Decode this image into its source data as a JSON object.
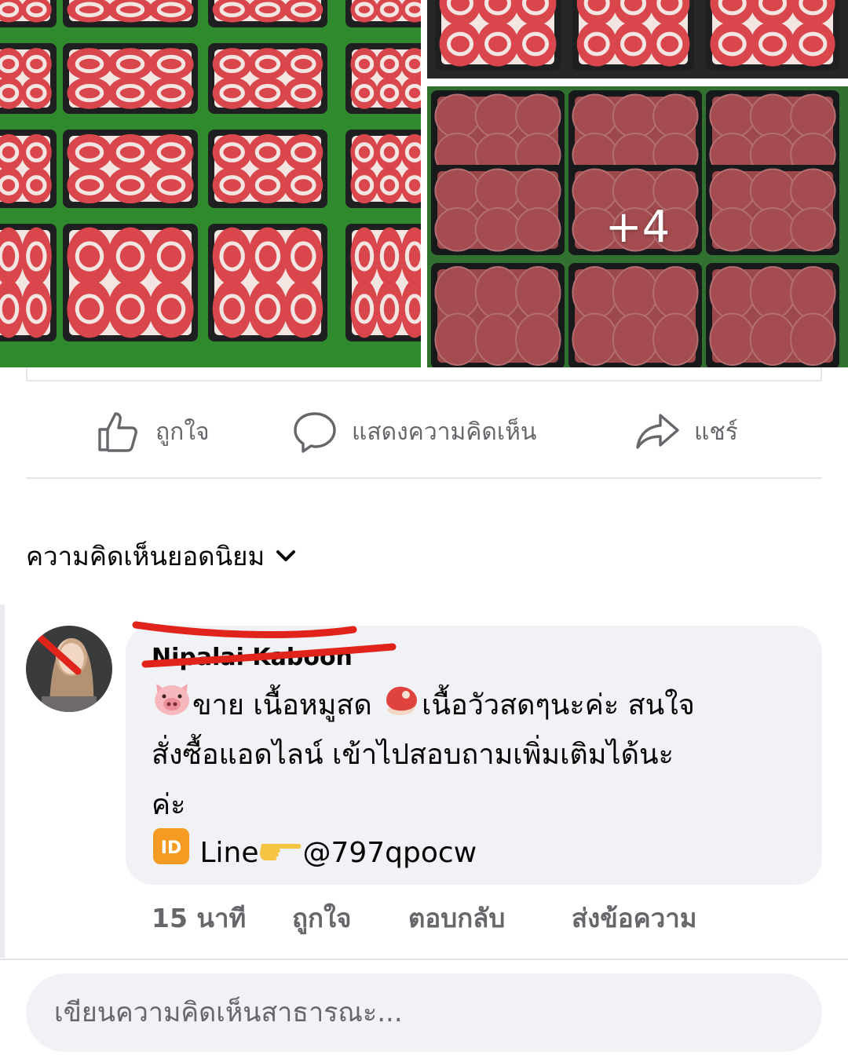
{
  "photos": {
    "more_count": "+4"
  },
  "actions": {
    "like": "ถูกใจ",
    "comment": "แสดงความคิดเห็น",
    "share": "แชร์"
  },
  "comments_section": {
    "sort_label": "ความคิดเห็นยอดนิยม"
  },
  "comment": {
    "author": "Nipalai Kaboon",
    "line1_a": "ขาย เนื้อหมูสด ",
    "line1_b": "เนื้อวัวสดๆนะค่ะ สนใจ",
    "line2": "สั่งซื้อแอดไลน์ เข้าไปสอบถามเพิ่มเติมได้นะ",
    "line3": "ค่ะ",
    "line4_a": " Line",
    "line4_b": "@797qpocw",
    "time": "15 นาที",
    "like": "ถูกใจ",
    "reply": "ตอบกลับ",
    "message": "ส่งข้อความ"
  },
  "composer": {
    "placeholder": "เขียนความคิดเห็นสาธารณะ..."
  },
  "colors": {
    "meat_red": "#d9474d",
    "fat_white": "#f3e6e2",
    "tray_black": "#1e1f20",
    "grass": "#2f8a2e",
    "secondary_text": "#65676b",
    "bubble": "#f0f2f5",
    "scribble": "#e0231b"
  }
}
